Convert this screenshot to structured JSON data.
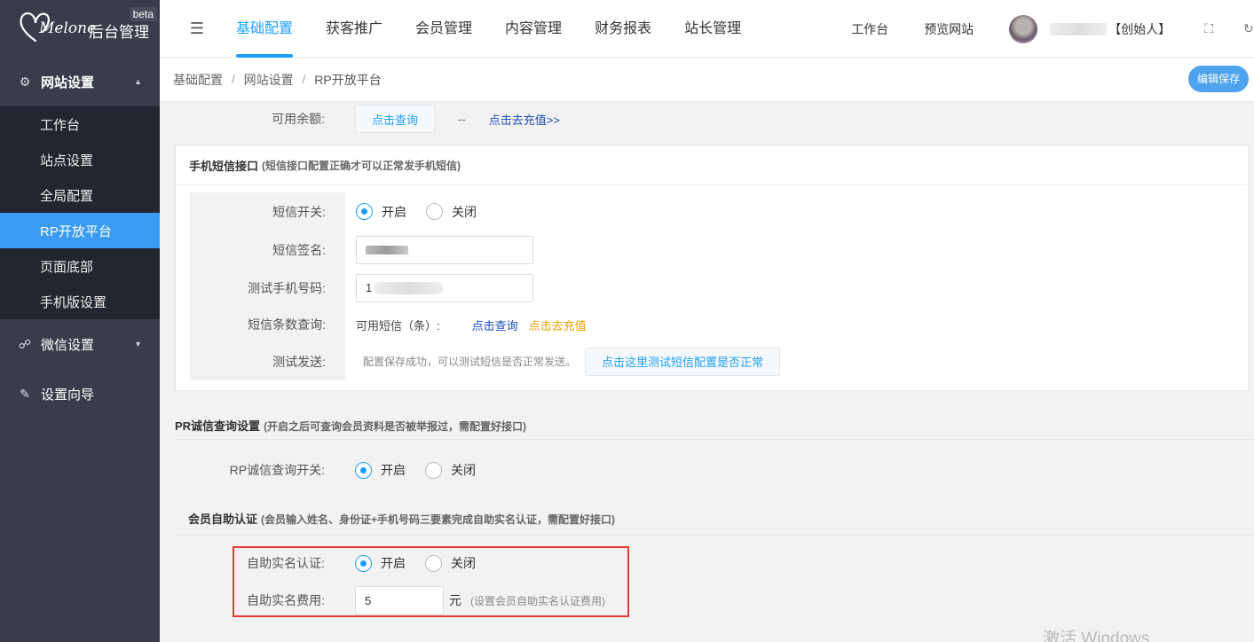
{
  "app": {
    "logo_script": "Melone",
    "title": "后台管理",
    "badge": "beta"
  },
  "sidebar": {
    "groups": [
      {
        "label": "网站设置",
        "icon": "gear-icon",
        "expanded": true,
        "items": [
          {
            "label": "工作台"
          },
          {
            "label": "站点设置"
          },
          {
            "label": "全局配置"
          },
          {
            "label": "RP开放平台",
            "active": true
          },
          {
            "label": "页面底部"
          },
          {
            "label": "手机版设置"
          }
        ]
      },
      {
        "label": "微信设置",
        "icon": "wechat-icon"
      },
      {
        "label": "设置向导",
        "icon": "edit-icon"
      }
    ]
  },
  "topnav": {
    "tabs": [
      "基础配置",
      "获客推广",
      "会员管理",
      "内容管理",
      "财务报表",
      "站长管理"
    ],
    "active": "基础配置",
    "right_links": [
      "工作台",
      "预览网站"
    ],
    "user_initial": "ा",
    "user_role": "【创始人】"
  },
  "breadcrumb": {
    "items": [
      "基础配置",
      "网站设置",
      "RP开放平台"
    ],
    "separator": "/"
  },
  "save_button": "编辑保存",
  "balance": {
    "label": "可用余额:",
    "query_btn": "点击查询",
    "value": "--",
    "recharge_link": "点击去充值>>"
  },
  "sms": {
    "title": "手机短信接口",
    "note": "(短信接口配置正确才可以正常发手机短信)",
    "switch_label": "短信开关:",
    "on_label": "开启",
    "off_label": "关闭",
    "sign_label": "短信签名:",
    "sign_value": "",
    "phone_label": "测试手机号码:",
    "phone_value": "1",
    "count_label": "短信条数查询:",
    "count_text": "可用短信（条）:",
    "count_query": "点击查询",
    "count_recharge": "点击去充值",
    "send_label": "测试发送:",
    "send_hint": "配置保存成功，可以测试短信是否正常发送。",
    "send_btn": "点击这里测试短信配置是否正常"
  },
  "credit": {
    "title": "PR诚信查询设置",
    "note": "(开启之后可查询会员资料是否被举报过，需配置好接口)",
    "switch_label": "RP诚信查询开关:",
    "on_label": "开启",
    "off_label": "关闭"
  },
  "auth": {
    "title": "会员自助认证",
    "note": "(会员输入姓名、身份证+手机号码三要素完成自助实名认证，需配置好接口)",
    "switch_label": "自助实名认证:",
    "on_label": "开启",
    "off_label": "关闭",
    "fee_label": "自助实名费用:",
    "fee_value": "5",
    "fee_unit": "元",
    "fee_hint": "(设置会员自助实名认证费用)"
  },
  "watermark": "激活 Windows",
  "colors": {
    "accent": "#1e9fff",
    "sidebar": "#393d49",
    "sidebar_sub": "#23262e",
    "active_item": "#3a9bf5",
    "highlight": "#e53935"
  }
}
